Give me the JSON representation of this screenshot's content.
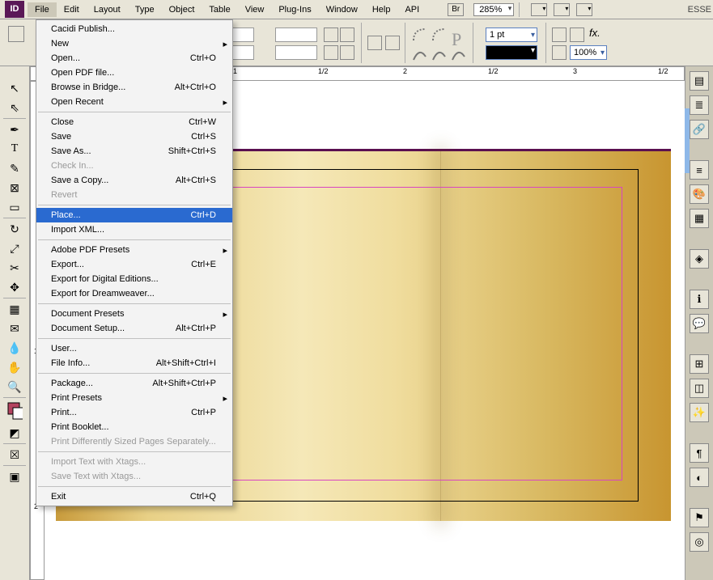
{
  "menubar": [
    "File",
    "Edit",
    "Layout",
    "Type",
    "Object",
    "Table",
    "View",
    "Plug-Ins",
    "Window",
    "Help",
    "API"
  ],
  "br_label": "Br",
  "zoom": "285%",
  "workspace_hint": "ESSE",
  "stroke_weight": "1 pt",
  "opacity": "100%",
  "ruler_h": [
    "1",
    "1/2",
    "2",
    "1/2",
    "3",
    "1/2"
  ],
  "ruler_v": [
    "1",
    "2"
  ],
  "file_menu": [
    {
      "t": "item",
      "label": "Cacidi Publish...",
      "sc": ""
    },
    {
      "t": "item",
      "label": "New",
      "sc": "",
      "sub": true
    },
    {
      "t": "item",
      "label": "Open...",
      "sc": "Ctrl+O"
    },
    {
      "t": "item",
      "label": "Open PDF file...",
      "sc": ""
    },
    {
      "t": "item",
      "label": "Browse in Bridge...",
      "sc": "Alt+Ctrl+O"
    },
    {
      "t": "item",
      "label": "Open Recent",
      "sc": "",
      "sub": true
    },
    {
      "t": "sep"
    },
    {
      "t": "item",
      "label": "Close",
      "sc": "Ctrl+W"
    },
    {
      "t": "item",
      "label": "Save",
      "sc": "Ctrl+S"
    },
    {
      "t": "item",
      "label": "Save As...",
      "sc": "Shift+Ctrl+S"
    },
    {
      "t": "item",
      "label": "Check In...",
      "sc": "",
      "disabled": true
    },
    {
      "t": "item",
      "label": "Save a Copy...",
      "sc": "Alt+Ctrl+S"
    },
    {
      "t": "item",
      "label": "Revert",
      "sc": "",
      "disabled": true
    },
    {
      "t": "sep"
    },
    {
      "t": "item",
      "label": "Place...",
      "sc": "Ctrl+D",
      "sel": true
    },
    {
      "t": "item",
      "label": "Import XML...",
      "sc": ""
    },
    {
      "t": "sep"
    },
    {
      "t": "item",
      "label": "Adobe PDF Presets",
      "sc": "",
      "sub": true
    },
    {
      "t": "item",
      "label": "Export...",
      "sc": "Ctrl+E"
    },
    {
      "t": "item",
      "label": "Export for Digital Editions...",
      "sc": ""
    },
    {
      "t": "item",
      "label": "Export for Dreamweaver...",
      "sc": ""
    },
    {
      "t": "sep"
    },
    {
      "t": "item",
      "label": "Document Presets",
      "sc": "",
      "sub": true
    },
    {
      "t": "item",
      "label": "Document Setup...",
      "sc": "Alt+Ctrl+P"
    },
    {
      "t": "sep"
    },
    {
      "t": "item",
      "label": "User...",
      "sc": ""
    },
    {
      "t": "item",
      "label": "File Info...",
      "sc": "Alt+Shift+Ctrl+I"
    },
    {
      "t": "sep"
    },
    {
      "t": "item",
      "label": "Package...",
      "sc": "Alt+Shift+Ctrl+P"
    },
    {
      "t": "item",
      "label": "Print Presets",
      "sc": "",
      "sub": true
    },
    {
      "t": "item",
      "label": "Print...",
      "sc": "Ctrl+P"
    },
    {
      "t": "item",
      "label": "Print Booklet...",
      "sc": ""
    },
    {
      "t": "item",
      "label": "Print Differently Sized Pages Separately...",
      "sc": "",
      "disabled": true
    },
    {
      "t": "sep"
    },
    {
      "t": "item",
      "label": "Import Text with Xtags...",
      "sc": "",
      "disabled": true
    },
    {
      "t": "item",
      "label": "Save Text with Xtags...",
      "sc": "",
      "disabled": true
    },
    {
      "t": "sep"
    },
    {
      "t": "item",
      "label": "Exit",
      "sc": "Ctrl+Q"
    }
  ],
  "tools": [
    "pointer",
    "direct-select",
    "pen",
    "type",
    "pencil",
    "rect-frame",
    "rect",
    "rotate",
    "scale",
    "scissors",
    "transform",
    "gradient",
    "note",
    "eyedropper",
    "hand",
    "zoom",
    "fill-stroke",
    "view-mode",
    "format-mode"
  ],
  "panels": [
    "pages",
    "layers",
    "links",
    "stroke",
    "color",
    "swatches",
    "grid",
    "object-styles",
    "info",
    "align",
    "pathfinder",
    "effects",
    "text-wrap",
    "tags"
  ]
}
